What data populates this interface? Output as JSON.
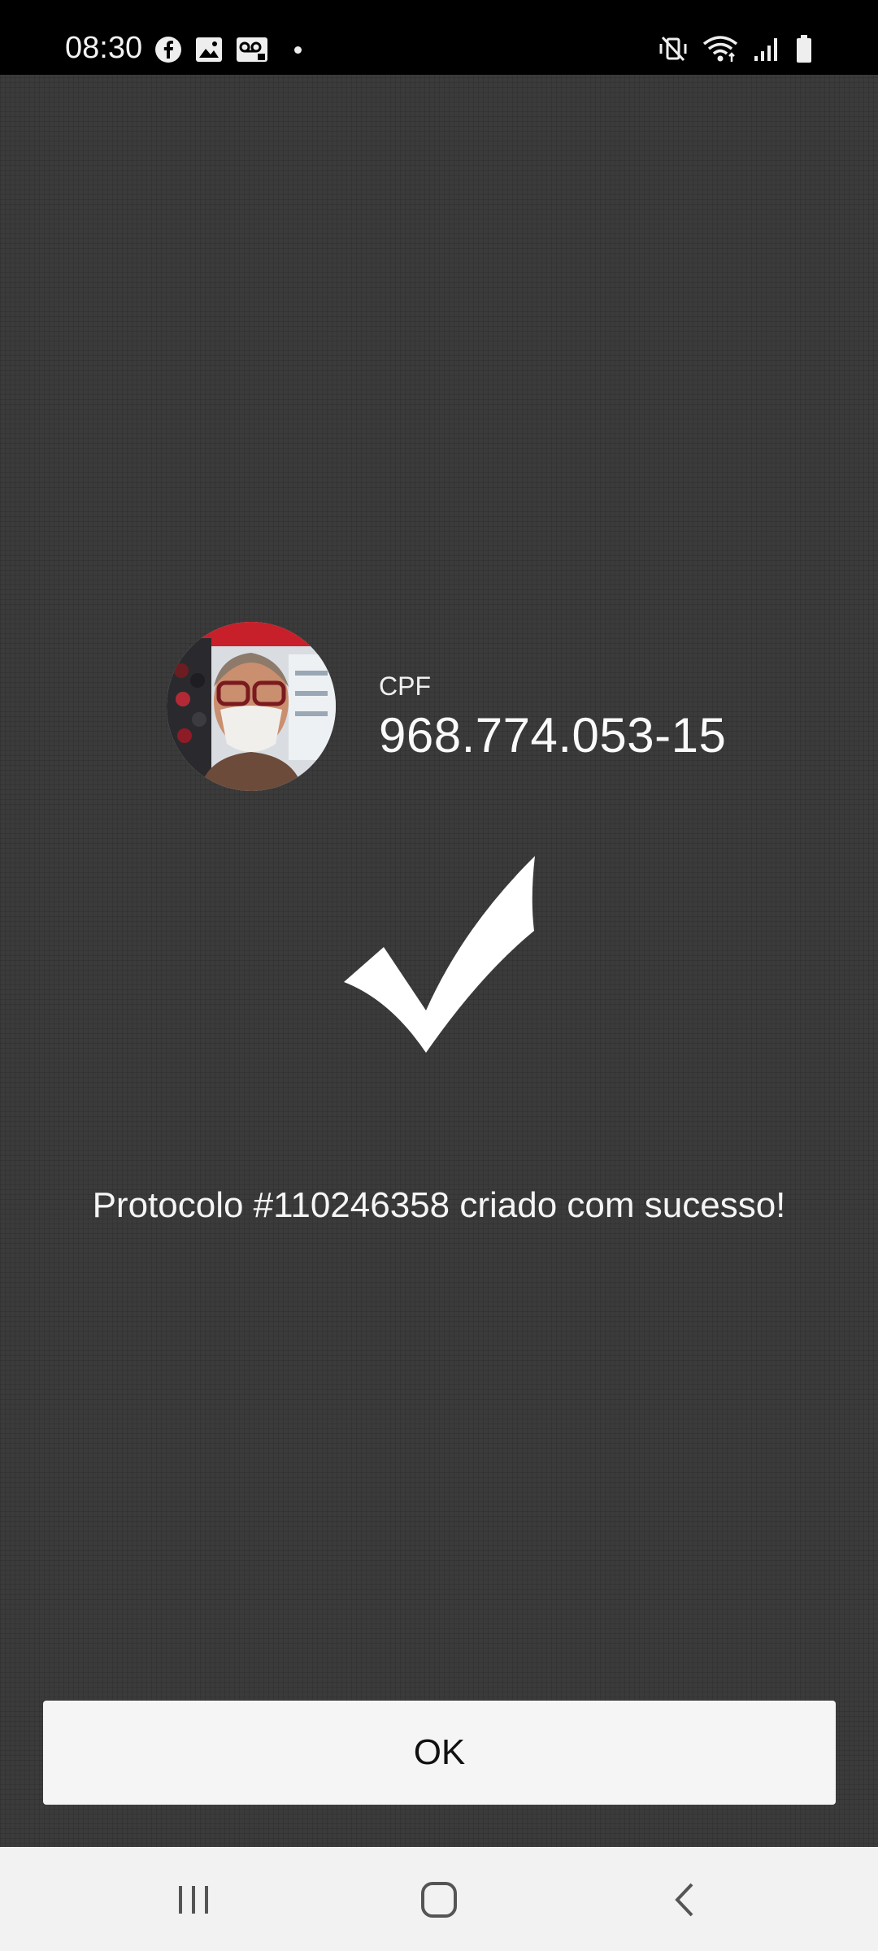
{
  "status_bar": {
    "time": "08:30",
    "left_icons": [
      "facebook-icon",
      "gallery-icon",
      "voicemail-icon",
      "dot-icon"
    ],
    "right_icons": [
      "vibrate-mute-icon",
      "wifi-icon",
      "signal-icon",
      "battery-icon"
    ]
  },
  "profile": {
    "cpf_label": "CPF",
    "cpf_value": "968.774.053-15"
  },
  "success": {
    "icon": "checkmark-icon",
    "message": "Protocolo #110246358 criado com sucesso!"
  },
  "actions": {
    "ok_label": "OK"
  },
  "nav_bar": {
    "buttons": [
      "recents-icon",
      "home-icon",
      "back-icon"
    ]
  },
  "colors": {
    "background": "#3b3b3b",
    "status_bar": "#000000",
    "button": "#f5f5f5",
    "nav_bar": "#f2f2f2"
  }
}
